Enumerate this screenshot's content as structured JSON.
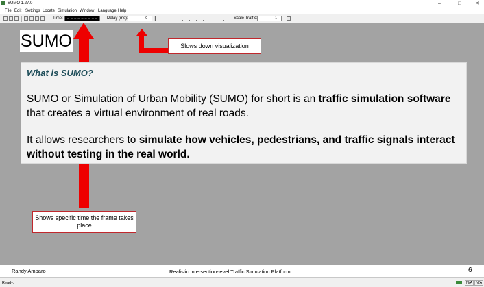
{
  "window": {
    "title": "SUMO 1.27.0",
    "minimize": "–",
    "maximize": "□",
    "close": "✕"
  },
  "menu": [
    "File",
    "Edit",
    "Settings",
    "Locate",
    "Simulation",
    "Window",
    "Language",
    "Help"
  ],
  "toolbar": {
    "time_label": "Time:",
    "delay_label": "Delay (ms):",
    "delay_value": "0",
    "scale_label": "Scale Traffic:",
    "scale_value": "1"
  },
  "slide": {
    "sumo_label": "SUMO",
    "callout_delay": "Slows down visualization",
    "callout_time": "Shows specific time the frame takes place",
    "heading": "What is SUMO?",
    "p1_a": "SUMO or Simulation of Urban Mobility (SUMO) for short is an ",
    "p1_b": "traffic simulation software",
    "p1_c": " that creates a virtual environment of real roads.",
    "p2_a": "It allows researchers to ",
    "p2_b": "simulate how vehicles, pedestrians, and traffic signals interact without testing in the real world."
  },
  "footer": {
    "author": "Randy Amparo",
    "title": "Realistic Intersection-level Traffic Simulation Platform",
    "page": "6"
  },
  "status": {
    "text": "Ready.",
    "na1": "N/A",
    "na2": "N/A"
  },
  "colors": {
    "arrow": "#ee0000",
    "callout_border": "#c0282d",
    "heading": "#1f4e5a",
    "canvas": "#a3a3a3"
  }
}
